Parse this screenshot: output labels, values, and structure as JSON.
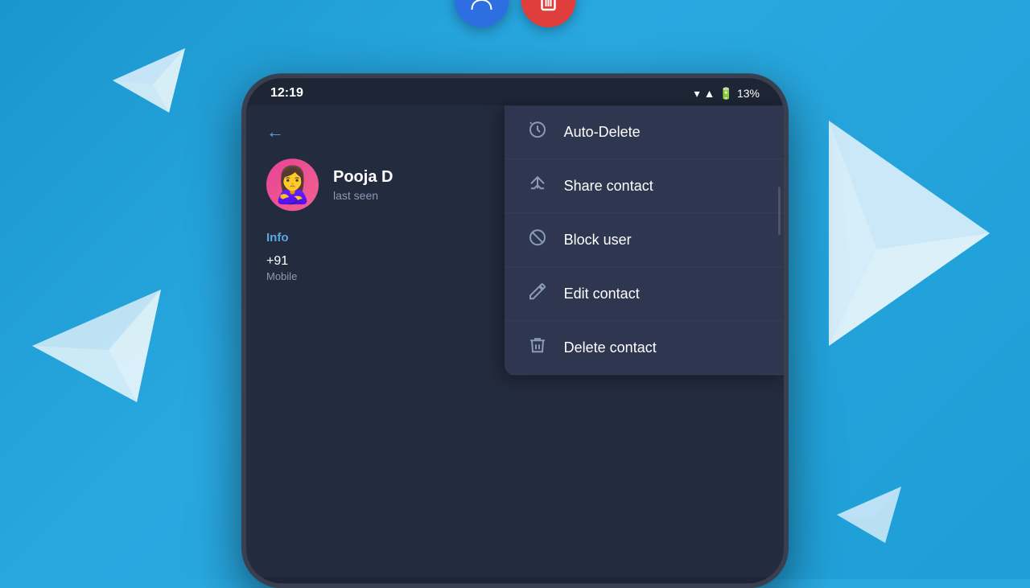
{
  "background": {
    "color": "#29a8e0"
  },
  "floating_icons": {
    "user_icon": "👤",
    "trash_icon": "🗑"
  },
  "status_bar": {
    "time": "12:19",
    "battery": "13%",
    "wifi": "▼",
    "signal": "▲"
  },
  "contact": {
    "name": "Pooja D",
    "status": "last seen",
    "phone": "+91",
    "phone_label": "Mobile",
    "avatar_emoji": "🙎‍♀️"
  },
  "sections": {
    "info_label": "Info"
  },
  "menu": {
    "items": [
      {
        "id": "auto-delete",
        "label": "Auto-Delete",
        "icon": "⏱"
      },
      {
        "id": "share-contact",
        "label": "Share contact",
        "icon": "↗"
      },
      {
        "id": "block-user",
        "label": "Block user",
        "icon": "⊘"
      },
      {
        "id": "edit-contact",
        "label": "Edit contact",
        "icon": "✏"
      },
      {
        "id": "delete-contact",
        "label": "Delete contact",
        "icon": "🗑"
      }
    ]
  },
  "nav": {
    "back_label": "←"
  }
}
